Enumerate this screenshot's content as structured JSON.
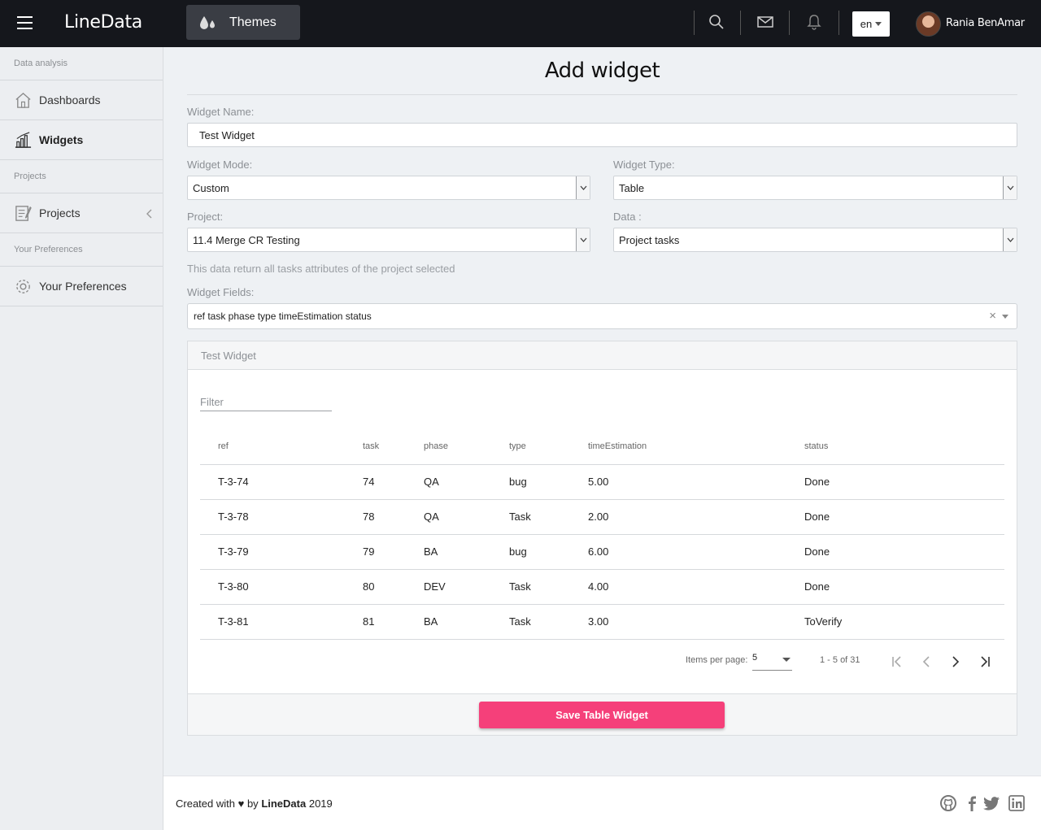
{
  "app": {
    "brand": "LineData",
    "themes_label": "Themes",
    "language": "en",
    "user_name": "Rania BenAmar"
  },
  "sidebar": {
    "sections": [
      {
        "title": "Data analysis"
      },
      {
        "title": "Projects"
      },
      {
        "title": "Your Preferences"
      }
    ],
    "items": [
      {
        "label": "Dashboards",
        "icon": "home-icon"
      },
      {
        "label": "Widgets",
        "icon": "bar-chart-icon",
        "active": true
      },
      {
        "label": "Projects",
        "icon": "notebook-icon"
      },
      {
        "label": "Your Preferences",
        "icon": "gear-icon"
      }
    ]
  },
  "page": {
    "title": "Add widget"
  },
  "form": {
    "widget_name_label": "Widget Name:",
    "widget_name_value": "Test Widget",
    "widget_mode_label": "Widget Mode:",
    "widget_mode_value": "Custom",
    "widget_type_label": "Widget Type:",
    "widget_type_value": "Table",
    "project_label": "Project:",
    "project_value": "11.4 Merge CR Testing",
    "data_label": "Data :",
    "data_value": "Project tasks",
    "hint": "This data return all tasks attributes of the project selected",
    "fields_label": "Widget Fields:",
    "fields_value": "ref task phase type timeEstimation status",
    "clear_symbol": "×"
  },
  "preview": {
    "title": "Test Widget",
    "filter_placeholder": "Filter",
    "columns": [
      "ref",
      "task",
      "phase",
      "type",
      "timeEstimation",
      "status"
    ],
    "rows": [
      [
        "T-3-74",
        "74",
        "QA",
        "bug",
        "5.00",
        "Done"
      ],
      [
        "T-3-78",
        "78",
        "QA",
        "Task",
        "2.00",
        "Done"
      ],
      [
        "T-3-79",
        "79",
        "BA",
        "bug",
        "6.00",
        "Done"
      ],
      [
        "T-3-80",
        "80",
        "DEV",
        "Task",
        "4.00",
        "Done"
      ],
      [
        "T-3-81",
        "81",
        "BA",
        "Task",
        "3.00",
        "ToVerify"
      ]
    ],
    "items_per_page_label": "Items per page:",
    "items_per_page_value": "5",
    "range_label": "1 - 5 of 31",
    "save_label": "Save Table Widget"
  },
  "footer": {
    "prefix": "Created with",
    "heart": "♥",
    "by": "by",
    "company": "LineData",
    "year": "2019",
    "social": [
      "github-icon",
      "facebook-icon",
      "twitter-icon",
      "linkedin-icon"
    ]
  },
  "colors": {
    "topbar": "#15171c",
    "accent": "#f5407a",
    "sidebar_bg": "#eceef1",
    "page_bg": "#eef1f4"
  }
}
